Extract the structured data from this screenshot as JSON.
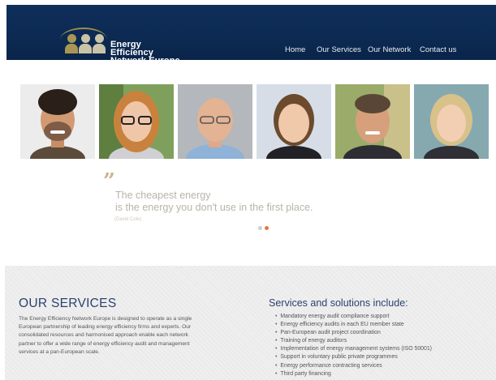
{
  "header": {
    "logo_line1": "Energy Efficiency",
    "logo_line2": "Network Europe",
    "nav": [
      {
        "label": "Home"
      },
      {
        "label": "Our Services"
      },
      {
        "label": "Our Network"
      },
      {
        "label": "Contact us"
      }
    ],
    "bg_color": "#0c2a52"
  },
  "quote": {
    "mark": "”",
    "line1": "The cheapest energy",
    "line2": "is the energy you don't use in the first place.",
    "author": "(David Cole)"
  },
  "carousel": {
    "slides": 2,
    "active": 2,
    "active_color": "#e07a3c",
    "inactive_color": "#cfcfcf"
  },
  "services": {
    "title": "OUR SERVICES",
    "desc_lines": [
      "The Energy Efficiency Network Europe is designed to operate as a single",
      "European partnership of leading energy efficiency firms and experts. Our",
      "consolidated resources and harmonised approach enable each network",
      "partner to offer a wide range of energy efficiency audit and management",
      "services at a pan-European scale."
    ],
    "solutions_title": "Services and solutions include:",
    "solutions": [
      "Mandatory energy audit compliance support",
      "Energy efficiency audits in each EU member state",
      "Pan-European audit project coordination",
      "Training of energy auditors",
      "Implementation of energy management systems (ISO 50001)",
      "Support in voluntary public private programmes",
      "Energy performance contracting services",
      "Third party financing"
    ]
  }
}
